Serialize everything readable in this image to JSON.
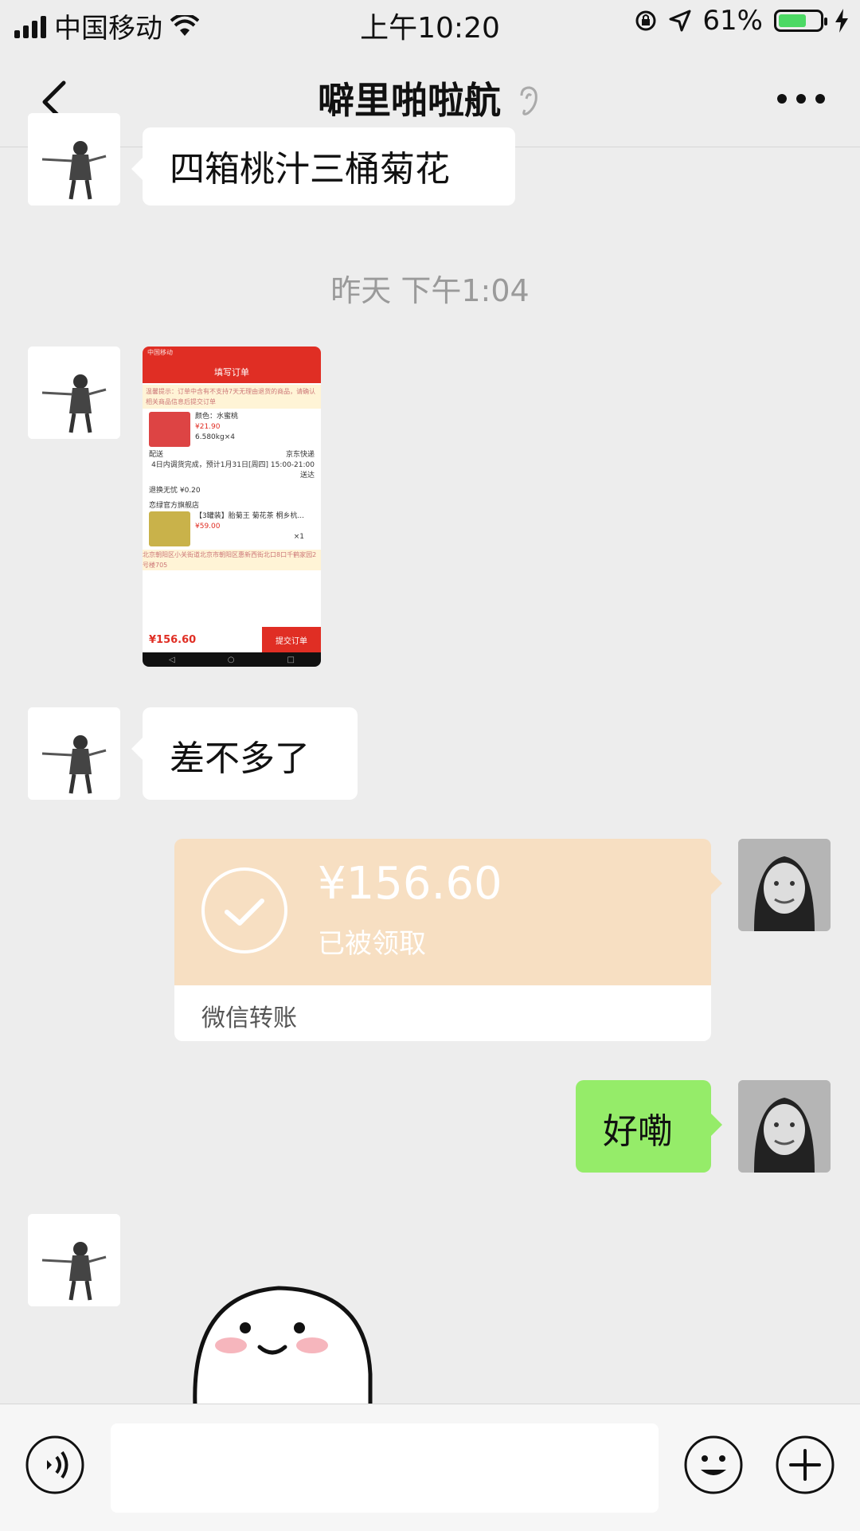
{
  "status_bar": {
    "carrier": "中国移动",
    "time": "上午10:20",
    "battery": "61%",
    "battery_level": 0.61
  },
  "header": {
    "title": "噼里啪啦航"
  },
  "messages": {
    "m1_text": "四箱桃汁三桶菊花",
    "timestamp": "昨天 下午1:04",
    "m3_text": "差不多了",
    "transfer": {
      "amount": "¥156.60",
      "status": "已被领取",
      "label": "微信转账"
    },
    "m5_text": "好嘞"
  },
  "screenshot_image": {
    "status": "中国移动",
    "title": "填写订单",
    "notice": "温馨提示：订单中含有不支持7天无理由退货的商品，请确认相关商品信息后提交订单",
    "item1_color": "颜色：水蜜桃",
    "item1_price": "¥21.90",
    "item1_weight": "6.580kg×4",
    "delivery_label": "配送",
    "delivery_carrier": "京东快递",
    "delivery_info": "4日内调货完成，预计1月31日[周四] 15:00-21:00送达",
    "insurance": "退换无忧 ¥0.20",
    "shop": "恋绿官方旗舰店",
    "item2_title": "【3罐装】胎菊王 菊花茶 桐乡杭...",
    "item2_price": "¥59.00",
    "item2_qty": "×1",
    "address": "北京朝阳区小关街道北京市朝阳区惠新西街北口8口千鹤家园2号楼705",
    "total": "¥156.60",
    "submit": "提交订单"
  },
  "colors": {
    "chat_bg": "#ededed",
    "green_bubble": "#95ec69",
    "transfer_bg": "#f7dfc2",
    "jd_red": "#e02e24"
  }
}
